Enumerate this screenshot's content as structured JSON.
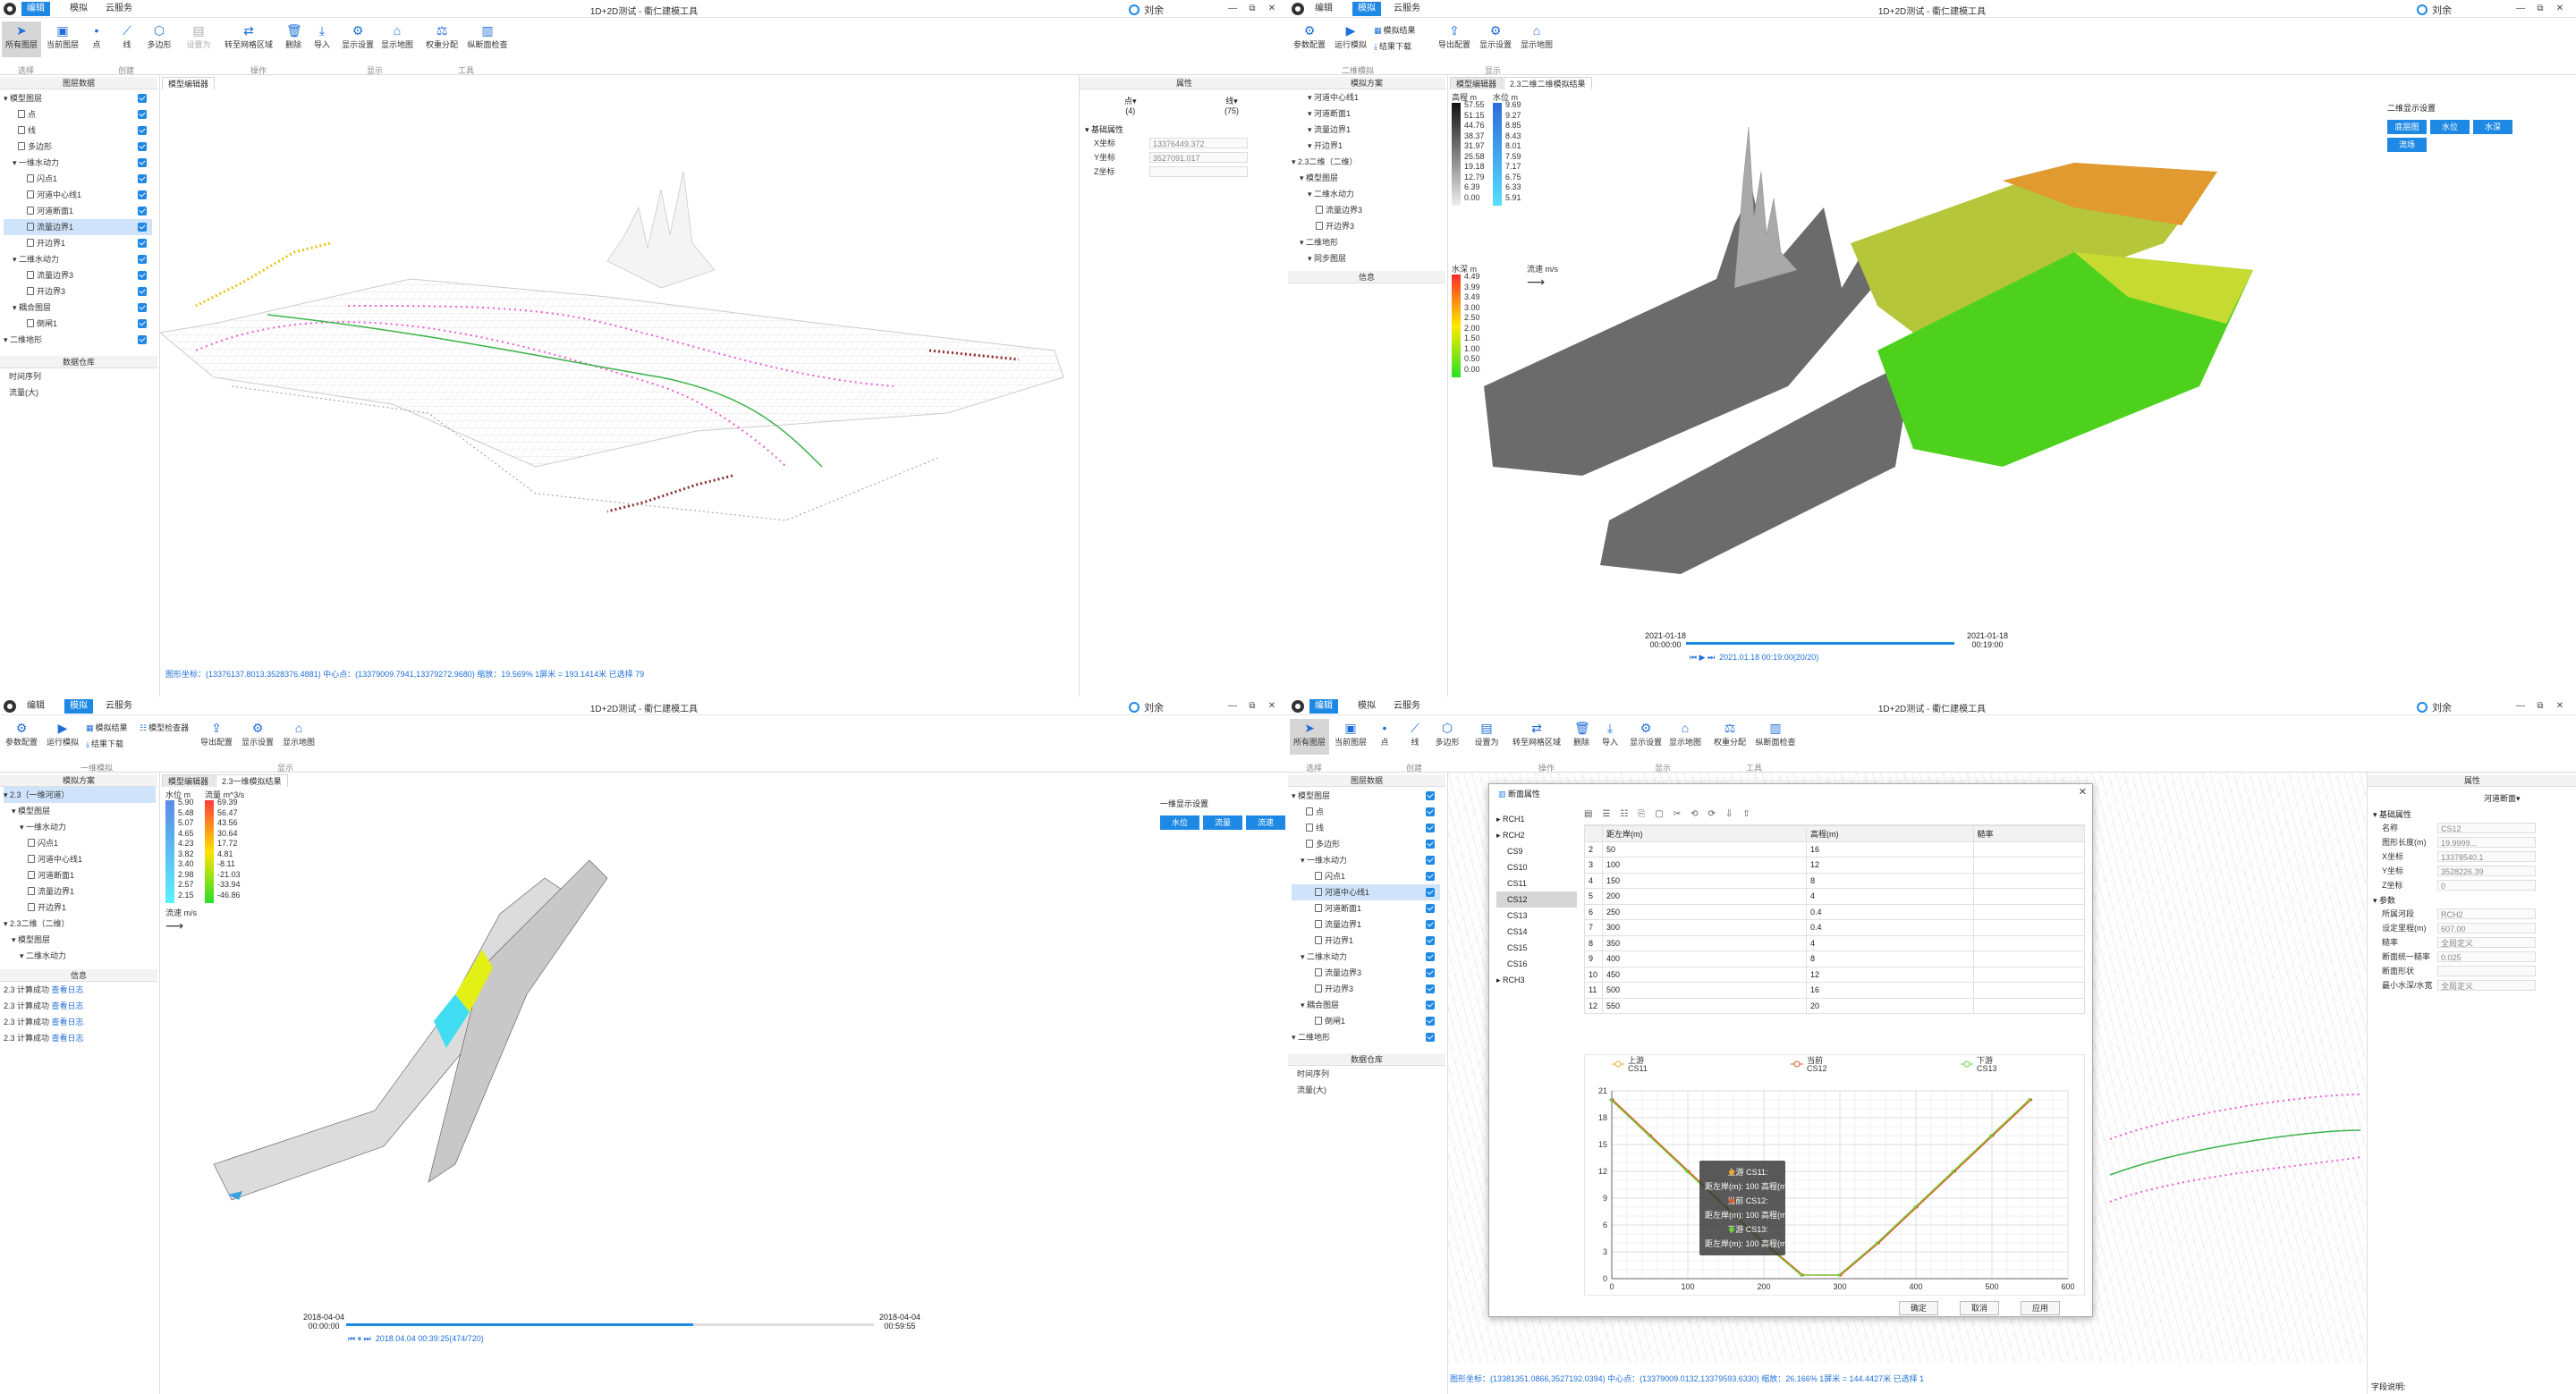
{
  "common": {
    "user": "刘余",
    "title": "1D+2D测试 - 衢仁建模工具",
    "win_ctl": [
      "—",
      "⧉",
      "✕"
    ]
  },
  "q1": {
    "menu": [
      "编辑",
      "模拟",
      "云服务"
    ],
    "ribbon": {
      "all_layers": "所有图层",
      "draw_layer": "当前图层",
      "point": "点",
      "line": "线",
      "polygon": "多边形",
      "set_as": "设置为",
      "convert_grid": "转至网格区域",
      "delete": "删除",
      "import": "导入",
      "display": "显示设置",
      "show_map": "显示地图",
      "weight": "权重分配",
      "section": "纵断面检查",
      "groups": [
        "选择",
        "创建",
        "操作",
        "显示",
        "工具"
      ]
    },
    "left_title": "图层数据",
    "tree": [
      [
        "模型图层",
        0,
        true
      ],
      [
        "点",
        1,
        false
      ],
      [
        "线",
        1,
        false
      ],
      [
        "多边形",
        1,
        false
      ],
      [
        "一维水动力",
        1,
        true
      ],
      [
        "闪点1",
        2,
        false
      ],
      [
        "河道中心线1",
        2,
        false
      ],
      [
        "河道断面1",
        2,
        false
      ],
      [
        "流量边界1",
        2,
        false
      ],
      [
        "开边界1",
        2,
        false
      ],
      [
        "二维水动力",
        1,
        true
      ],
      [
        "流量边界3",
        2,
        false
      ],
      [
        "开边界3",
        2,
        false
      ],
      [
        "耦合图层",
        1,
        true
      ],
      [
        "倒闸1",
        2,
        false
      ],
      [
        "二维地形",
        0,
        true
      ]
    ],
    "selected": 8,
    "repo_title": "数据仓库",
    "repo": [
      "时间序列",
      "流量(大)"
    ],
    "tab": "模型编辑器",
    "status": "图形坐标：(13376137.8013,3528376.4881)    中心点：(13379009.7941,13379272.9680)    缩放：19.569%    1屏米 = 193.1414米    已选择 79",
    "props_title": "属性",
    "props_tabs": [
      "点▾",
      "线▾"
    ],
    "props_counts": [
      "(4)",
      "(75)"
    ],
    "props_group": "基础属性",
    "props": [
      [
        "X坐标",
        "13376449.372"
      ],
      [
        "Y坐标",
        "3527091.017"
      ],
      [
        "Z坐标",
        ""
      ]
    ]
  },
  "q2": {
    "menu": [
      "编辑",
      "模拟",
      "云服务"
    ],
    "ribbon": {
      "params": "参数配置",
      "run": "运行模拟",
      "sim_result": "模拟结果",
      "load_result": "结果下载",
      "export": "导出配置",
      "display": "显示设置",
      "show_map": "显示地图",
      "groups": [
        "二维模拟",
        "显示"
      ]
    },
    "left_title": "模拟方案",
    "tree": [
      [
        "河道中心线1",
        2
      ],
      [
        "河道断面1",
        2
      ],
      [
        "流量边界1",
        2
      ],
      [
        "开边界1",
        2
      ],
      [
        "2.3二维（二维）",
        0
      ],
      [
        "模型图层",
        1
      ],
      [
        "二维水动力",
        2
      ],
      [
        "流量边界3",
        3
      ],
      [
        "开边界3",
        3
      ],
      [
        "二维地形",
        1
      ],
      [
        "同步图层",
        2
      ]
    ],
    "info_title": "信息",
    "tabs": [
      "模型编辑器",
      "2.3二维二维模拟结果"
    ],
    "legend1": {
      "title": "高程 m",
      "values": [
        "57.55",
        "51.15",
        "44.76",
        "38.37",
        "31.97",
        "25.58",
        "19.18",
        "12.79",
        "6.39",
        "0.00"
      ]
    },
    "legend2": {
      "title": "水位 m",
      "values": [
        "9.69",
        "9.27",
        "8.85",
        "8.43",
        "8.01",
        "7.59",
        "7.17",
        "6.75",
        "6.33",
        "5.91"
      ]
    },
    "legend3": {
      "title": "水深 m",
      "values": [
        "4.49",
        "3.99",
        "3.49",
        "3.00",
        "2.50",
        "2.00",
        "1.50",
        "1.00",
        "0.50",
        "0.00"
      ]
    },
    "legend4": {
      "title": "流速 m/s"
    },
    "view_title": "二维显示设置",
    "view_btns": [
      "底层图",
      "水位",
      "水深",
      "流场"
    ],
    "time": {
      "start": "2021-01-18\n00:00:00",
      "end": "2021-01-18\n00:19:00",
      "cur": "2021.01.18 00:19:00(20/20)",
      "progress": 1.0
    }
  },
  "q3": {
    "menu": [
      "编辑",
      "模拟",
      "云服务"
    ],
    "ribbon": {
      "params": "参数配置",
      "run": "运行模拟",
      "sim_result": "模拟结果",
      "load_result": "结果下载",
      "check": "模型检查器",
      "export": "导出配置",
      "display": "显示设置",
      "show_map": "显示地图",
      "groups": [
        "一维模拟",
        "显示"
      ]
    },
    "left_title": "模拟方案",
    "tree": [
      [
        "2.3（一维河道）",
        0
      ],
      [
        "模型图层",
        1
      ],
      [
        "一维水动力",
        2
      ],
      [
        "闪点1",
        3
      ],
      [
        "河道中心线1",
        3
      ],
      [
        "河道断面1",
        3
      ],
      [
        "流量边界1",
        3
      ],
      [
        "开边界1",
        3
      ],
      [
        "2.3二维（二维）",
        0
      ],
      [
        "模型图层",
        1
      ],
      [
        "二维水动力",
        2
      ]
    ],
    "info_title": "信息",
    "logs": [
      [
        "2.3 计算成功 ",
        "查看日志"
      ],
      [
        "2.3 计算成功 ",
        "查看日志"
      ],
      [
        "2.3 计算成功 ",
        "查看日志"
      ],
      [
        "2.3 计算成功 ",
        "查看日志"
      ]
    ],
    "tabs": [
      "模型编辑器",
      "2.3一维模拟结果"
    ],
    "legend1": {
      "title": "水位 m",
      "values": [
        "5.90",
        "5.48",
        "5.07",
        "4.65",
        "4.23",
        "3.82",
        "3.40",
        "2.98",
        "2.57",
        "2.15"
      ]
    },
    "legend2": {
      "title": "流量 m^3/s",
      "values": [
        "69.39",
        "56.47",
        "43.56",
        "30.64",
        "17.72",
        "4.81",
        "-8.11",
        "-21.03",
        "-33.94",
        "-46.86"
      ]
    },
    "legend3": {
      "title": "流速 m/s"
    },
    "view_title": "一维显示设置",
    "view_btns": [
      "水位",
      "流量",
      "流速"
    ],
    "time": {
      "start": "2018-04-04\n00:00:00",
      "end": "2018-04-04\n00:59:55",
      "cur": "2018.04.04 00:39:25(474/720)",
      "progress": 0.658
    }
  },
  "q4": {
    "menu": [
      "编辑",
      "模拟",
      "云服务"
    ],
    "left_title": "图层数据",
    "tree": [
      [
        "模型图层",
        0,
        true
      ],
      [
        "点",
        1,
        false
      ],
      [
        "线",
        1,
        false
      ],
      [
        "多边形",
        1,
        false
      ],
      [
        "一维水动力",
        1,
        true
      ],
      [
        "闪点1",
        2,
        false
      ],
      [
        "河道中心线1",
        2,
        false
      ],
      [
        "河道断面1",
        2,
        false
      ],
      [
        "流量边界1",
        2,
        false
      ],
      [
        "开边界1",
        2,
        false
      ],
      [
        "二维水动力",
        1,
        true
      ],
      [
        "流量边界3",
        2,
        false
      ],
      [
        "开边界3",
        2,
        false
      ],
      [
        "耦合图层",
        1,
        true
      ],
      [
        "倒闸1",
        2,
        false
      ],
      [
        "二维地形",
        0,
        true
      ]
    ],
    "selected": 6,
    "repo_title": "数据仓库",
    "repo": [
      "时间序列",
      "流量(大)"
    ],
    "dialog": {
      "title": "断面属性",
      "nodes": [
        "RCH1",
        "RCH2",
        "CS9",
        "CS10",
        "CS11",
        "CS12",
        "CS13",
        "CS14",
        "CS15",
        "CS16",
        "RCH3"
      ],
      "sel": "CS12",
      "headers": [
        "",
        "距左岸(m)",
        "高程(m)",
        "糙率"
      ],
      "rows": [
        [
          "2",
          "50",
          "16",
          ""
        ],
        [
          "3",
          "100",
          "12",
          ""
        ],
        [
          "4",
          "150",
          "8",
          ""
        ],
        [
          "5",
          "200",
          "4",
          ""
        ],
        [
          "6",
          "250",
          "0.4",
          ""
        ],
        [
          "7",
          "300",
          "0.4",
          ""
        ],
        [
          "8",
          "350",
          "4",
          ""
        ],
        [
          "9",
          "400",
          "8",
          ""
        ],
        [
          "10",
          "450",
          "12",
          ""
        ],
        [
          "11",
          "500",
          "16",
          ""
        ],
        [
          "12",
          "550",
          "20",
          ""
        ]
      ],
      "series": [
        "上游\nCS11",
        "当前\nCS12",
        "下游\nCS13"
      ],
      "tooltip": [
        [
          "上游 CS11:",
          ""
        ],
        [
          "距左岸(m): 100",
          "高程(m): 12"
        ],
        [
          "当前 CS12:",
          ""
        ],
        [
          "距左岸(m): 100",
          "高程(m): 12"
        ],
        [
          "下游 CS13:",
          ""
        ],
        [
          "距左岸(m): 100",
          "高程(m): 12"
        ]
      ],
      "buttons": [
        "确定",
        "取消",
        "应用"
      ]
    },
    "chart_data": {
      "type": "line",
      "x": [
        0,
        50,
        100,
        150,
        200,
        250,
        300,
        350,
        400,
        450,
        500,
        550
      ],
      "series": [
        {
          "name": "当前 CS12",
          "values": [
            20,
            16,
            12,
            8,
            4,
            0.4,
            0.4,
            4,
            8,
            12,
            16,
            20
          ]
        }
      ],
      "xlim": [
        0,
        600
      ],
      "ylim": [
        0,
        21
      ],
      "xticks": [
        0,
        100,
        200,
        300,
        400,
        500,
        600
      ],
      "yticks": [
        0,
        3,
        6,
        9,
        12,
        15,
        18,
        21
      ],
      "colors": [
        "#f5a623",
        "#e05a2a",
        "#6ccf3b"
      ]
    },
    "props_title": "属性",
    "props_tab": "河道断面▾",
    "props_group": "基础属性",
    "props": [
      [
        "名称",
        "CS12"
      ],
      [
        "图形长度(m)",
        "19.9999..."
      ],
      [
        "X坐标",
        "13378540.1"
      ],
      [
        "Y坐标",
        "3528226.39"
      ],
      [
        "Z坐标",
        "0"
      ]
    ],
    "param_group": "参数",
    "params": [
      [
        "所属河段",
        "RCH2"
      ],
      [
        "设定里程(m)",
        "607.00"
      ],
      [
        "糙率",
        "全局定义"
      ],
      [
        "断面统一糙率",
        "0.025"
      ],
      [
        "断面形状",
        ""
      ],
      [
        "最小水深/水宽",
        "全局定义"
      ]
    ],
    "field_desc": "字段说明:",
    "status": "图形坐标：(13381351.0866,3527192.0394)    中心点：(13379009.0132,13379593.6330)    缩放：26.166%    1屏米 = 144.4427米    已选择 1"
  }
}
